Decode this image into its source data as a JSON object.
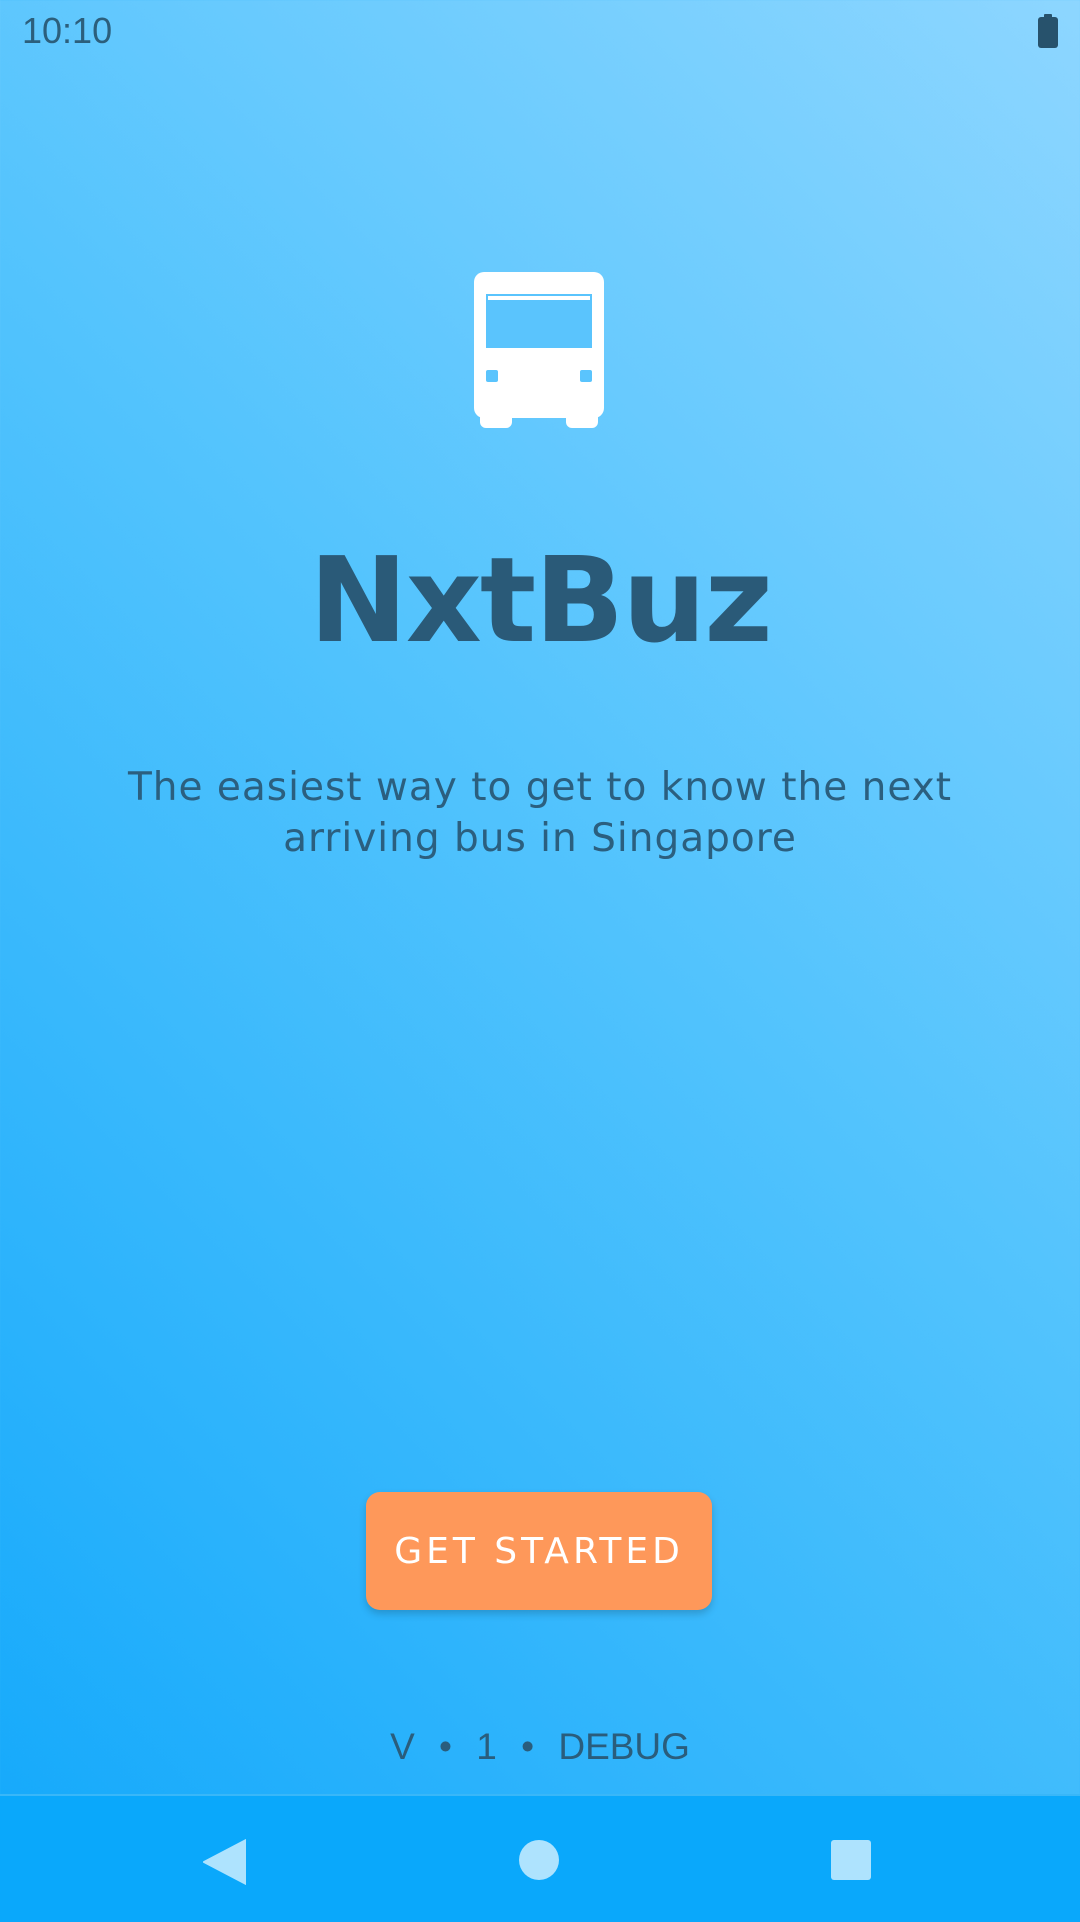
{
  "status_bar": {
    "time": "10:10",
    "battery_icon": "battery-full-icon"
  },
  "app": {
    "logo_icon": "bus-icon",
    "title": "NxtBuz",
    "tagline": "The easiest way to get to know the next arriving bus in Singapore"
  },
  "actions": {
    "get_started_label": "GET STARTED"
  },
  "footer": {
    "version_text": "V • 1 • DEBUG"
  },
  "nav_bar": {
    "back_icon": "back-triangle-icon",
    "home_icon": "home-circle-icon",
    "recents_icon": "recents-square-icon"
  },
  "colors": {
    "background_light": "#8dd6ff",
    "background_dark": "#12a8fb",
    "title_text": "#2a5a78",
    "button": "#fe985a",
    "nav_bar": "#0aa8fb"
  }
}
